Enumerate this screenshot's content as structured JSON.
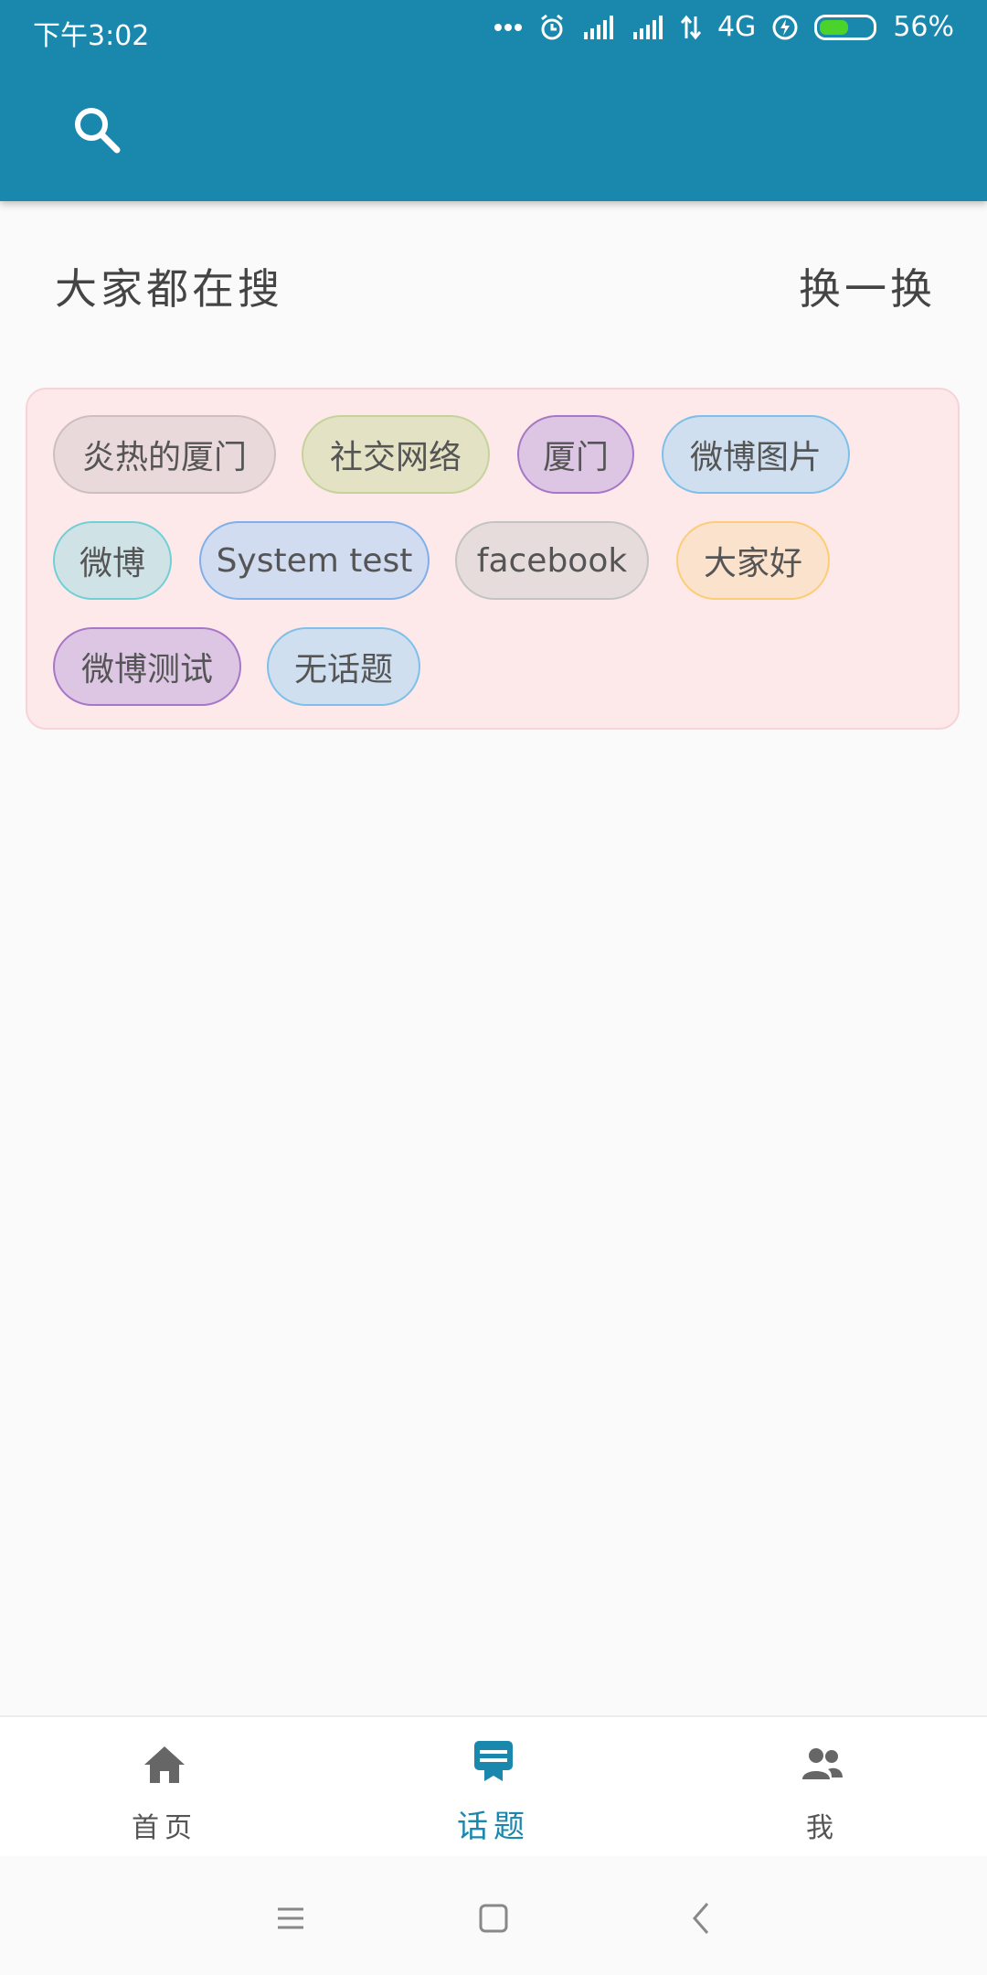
{
  "status_bar": {
    "time": "下午3:02",
    "network": "4G",
    "battery": "56%",
    "battery_level": 0.56
  },
  "app_bar": {
    "search_icon": "search-icon"
  },
  "trending": {
    "title": "大家都在搜",
    "refresh_label": "换一换",
    "tags": [
      {
        "label": "炎热的厦门",
        "bg": "#ead9da",
        "border": "#cdbfbf"
      },
      {
        "label": "社交网络",
        "bg": "#e4e2c4",
        "border": "#c5d39a"
      },
      {
        "label": "厦门",
        "bg": "#dcc6e4",
        "border": "#a776c6"
      },
      {
        "label": "微博图片",
        "bg": "#cfdff0",
        "border": "#7fc0e8"
      },
      {
        "label": "微博",
        "bg": "#cfe2e6",
        "border": "#70d0d6"
      },
      {
        "label": "System test",
        "bg": "#d2dcf0",
        "border": "#7fb0ea"
      },
      {
        "label": "facebook",
        "bg": "#e6dcdc",
        "border": "#c3c3c3"
      },
      {
        "label": "大家好",
        "bg": "#fbe2cc",
        "border": "#fccd76"
      },
      {
        "label": "微博测试",
        "bg": "#dcc6e4",
        "border": "#a776c6"
      },
      {
        "label": "无话题",
        "bg": "#cfdff0",
        "border": "#7fc0e8"
      }
    ]
  },
  "bottom_nav": {
    "items": [
      {
        "label": "首页",
        "icon": "home-icon"
      },
      {
        "label": "话题",
        "icon": "topic-icon",
        "active": true
      },
      {
        "label": "我",
        "icon": "people-icon"
      }
    ],
    "active_color": "#1a87ad"
  },
  "colors": {
    "primary": "#1a87ad",
    "panel": "#fde8ea"
  }
}
